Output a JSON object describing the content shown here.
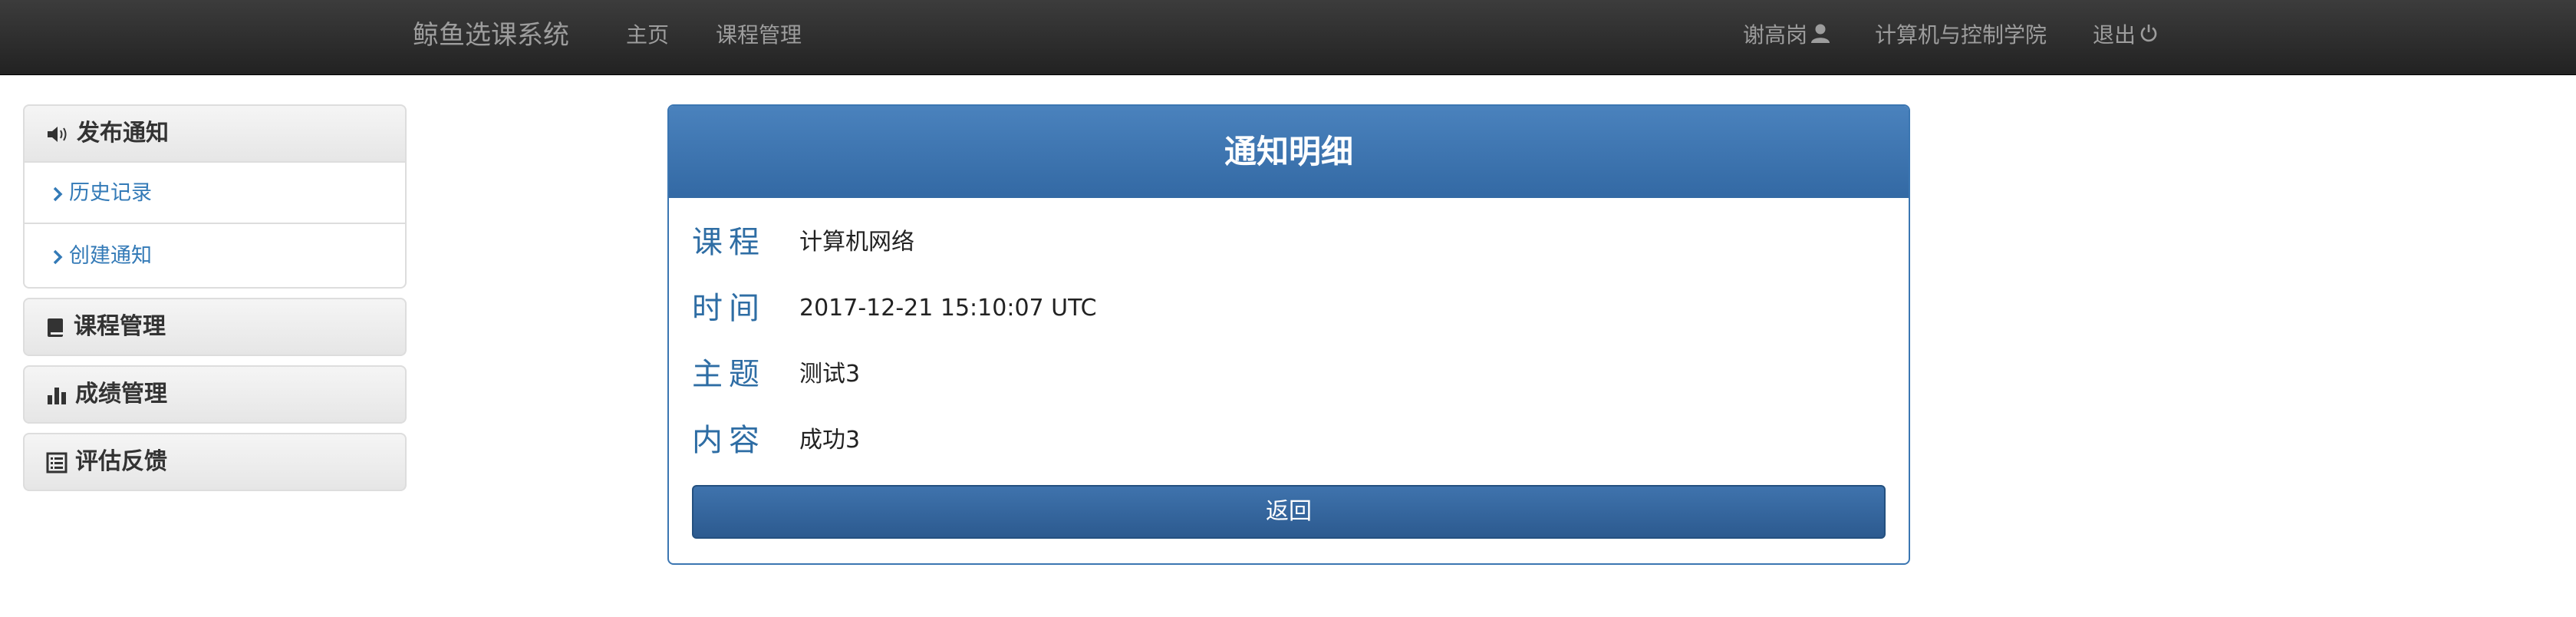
{
  "navbar": {
    "brand": "鲸鱼选课系统",
    "home": "主页",
    "course_manage": "课程管理",
    "user": "谢高岗",
    "school": "计算机与控制学院",
    "logout": "退出"
  },
  "sidebar": {
    "notice": {
      "label": "发布通知",
      "items": [
        {
          "label": "历史记录"
        },
        {
          "label": "创建通知"
        }
      ]
    },
    "course": {
      "label": "课程管理"
    },
    "grade": {
      "label": "成绩管理"
    },
    "feedback": {
      "label": "评估反馈"
    }
  },
  "notice": {
    "title": "通知明细",
    "rows": [
      {
        "label": "课程",
        "value": "计算机网络"
      },
      {
        "label": "时间",
        "value": "2017-12-21 15:10:07 UTC"
      },
      {
        "label": "主题",
        "value": "测试3"
      },
      {
        "label": "内容",
        "value": "成功3"
      }
    ],
    "back_label": "返回"
  },
  "colors": {
    "navbar": "#222222",
    "primary": "#337ab7",
    "panel_header": "#4178b5"
  }
}
